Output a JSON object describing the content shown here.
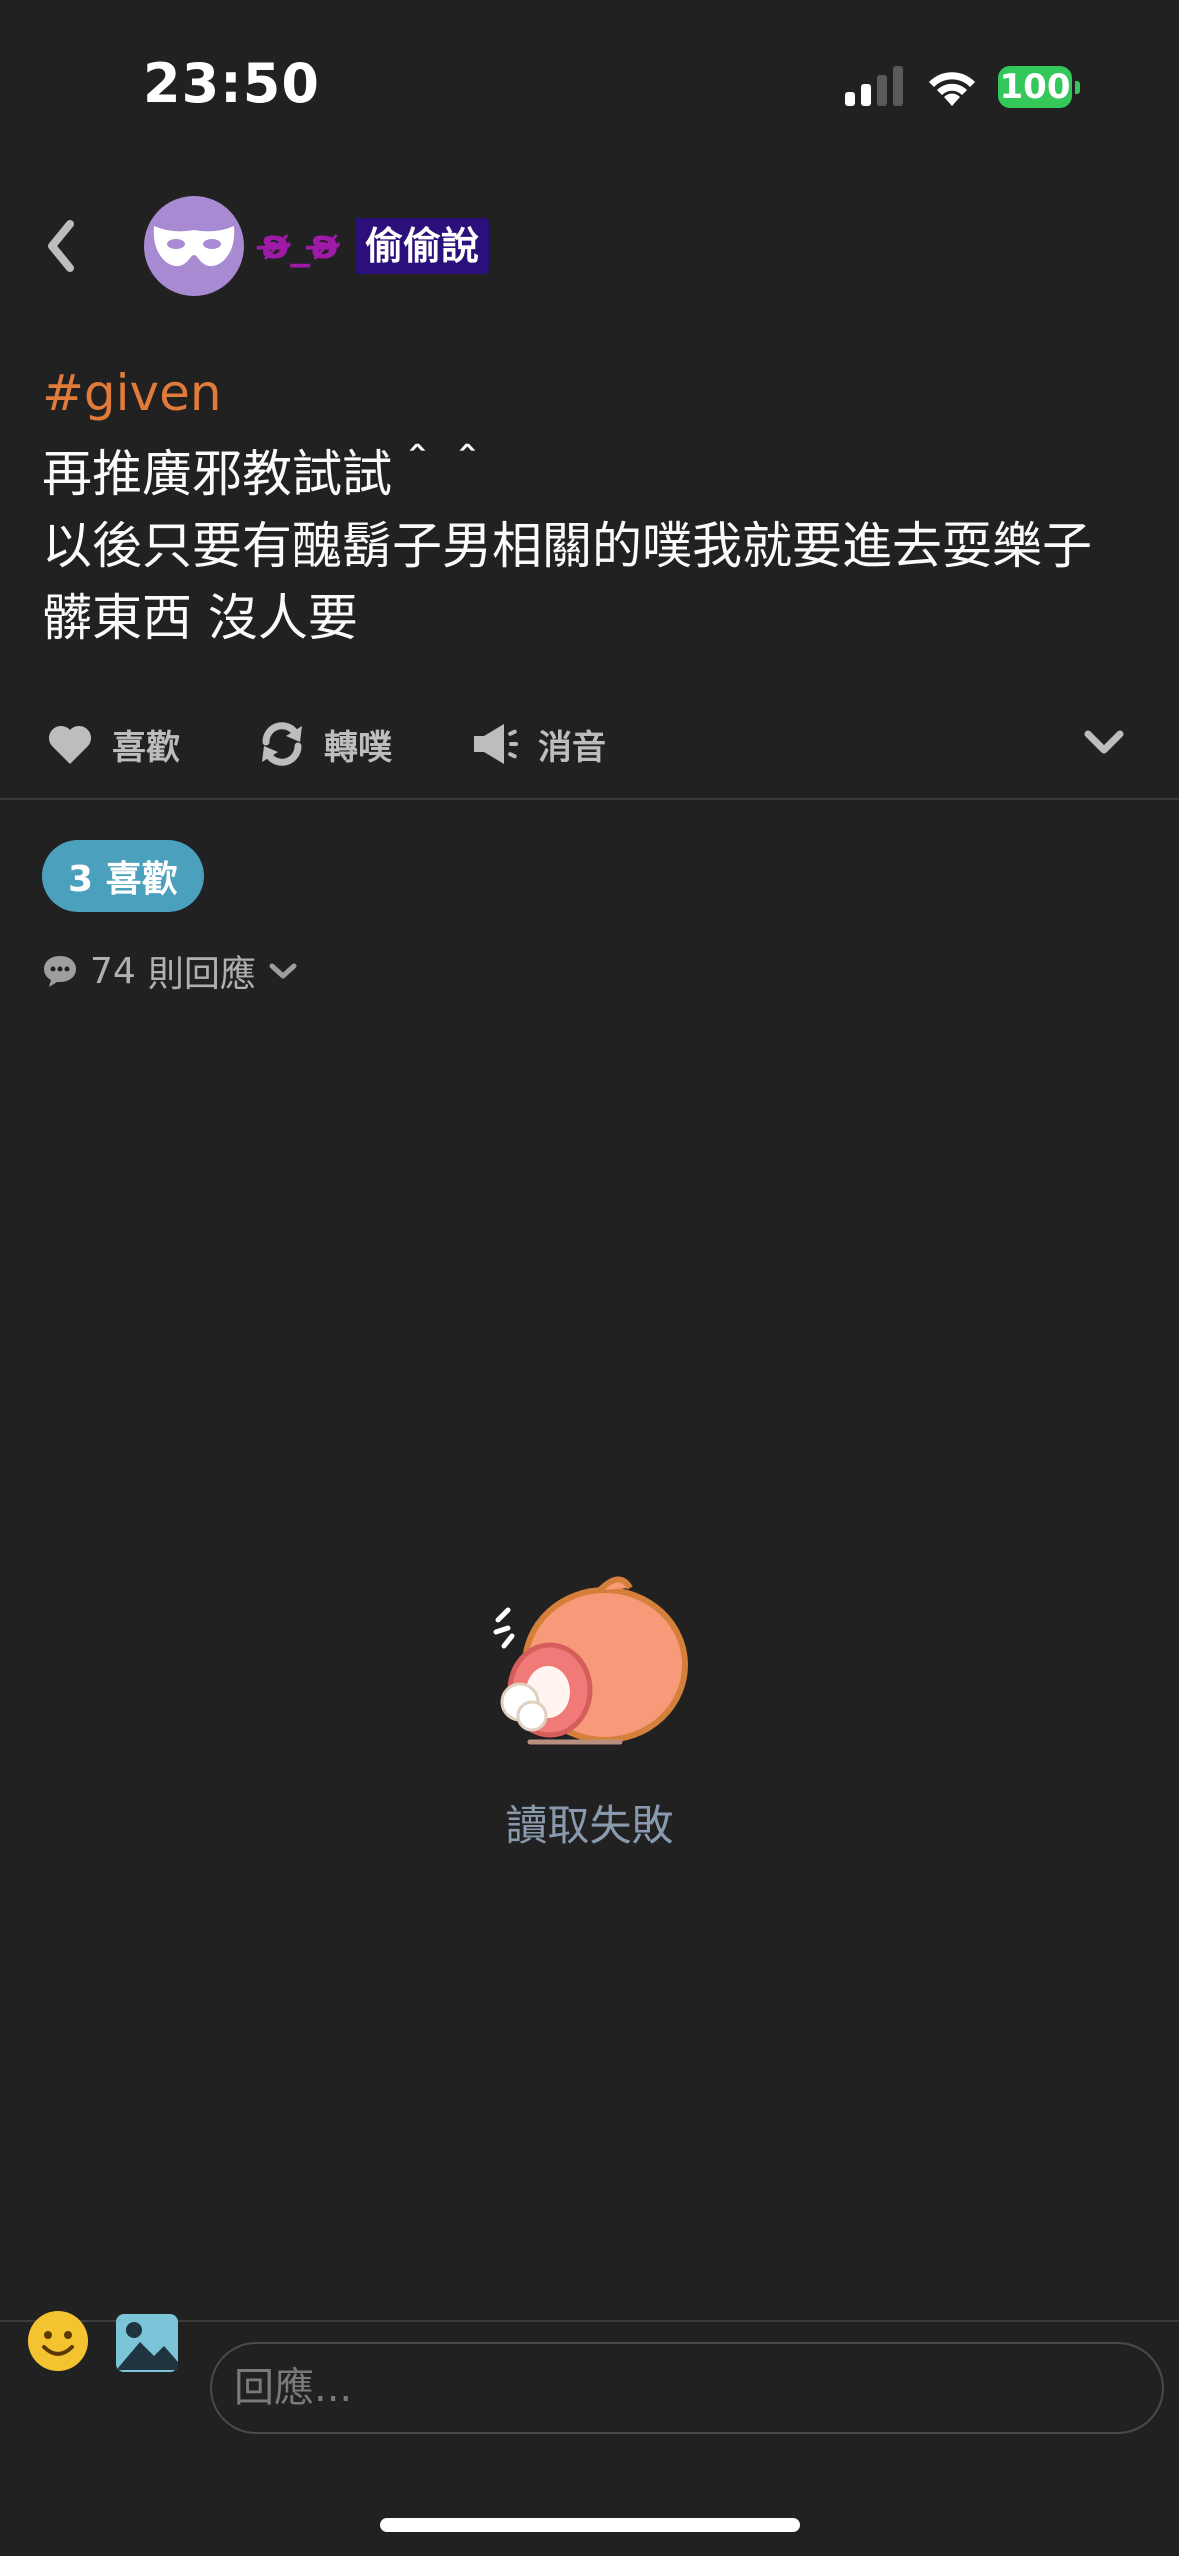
{
  "status_bar": {
    "time": "23:50",
    "battery": "100",
    "battery_color": "#34c759"
  },
  "header": {
    "username": "ʚ̴̶̷_ʚ̴̶̷",
    "badge": "偷偷說",
    "avatar_icon": "mask-icon"
  },
  "post": {
    "hashtag": "#given",
    "text": "再推廣邪教試試＾＾\n以後只要有醜鬍子男相關的噗我就要進去耍樂子\n髒東西 沒人要"
  },
  "actions": {
    "like": "喜歡",
    "replurk": "轉噗",
    "mute": "消音"
  },
  "likes_pill": "3 喜歡",
  "responses": {
    "count": "74",
    "label": "則回應"
  },
  "error": {
    "message": "讀取失敗"
  },
  "reply": {
    "placeholder": "回應..."
  }
}
